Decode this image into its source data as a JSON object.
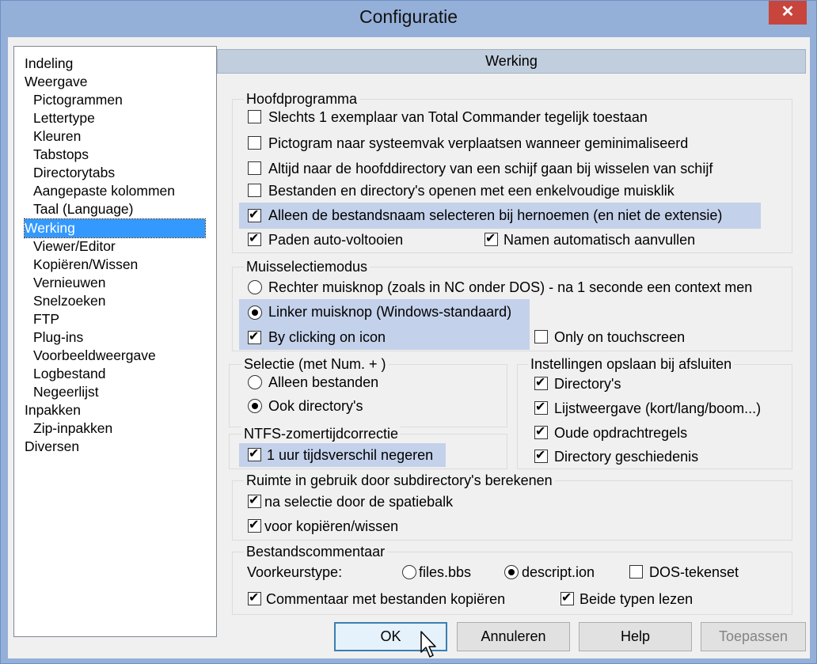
{
  "window": {
    "title": "Configuratie",
    "close_symbol": "✕"
  },
  "tree": {
    "items": [
      {
        "label": "Indeling",
        "level": 0
      },
      {
        "label": "Weergave",
        "level": 0
      },
      {
        "label": "Pictogrammen",
        "level": 1
      },
      {
        "label": "Lettertype",
        "level": 1
      },
      {
        "label": "Kleuren",
        "level": 1
      },
      {
        "label": "Tabstops",
        "level": 1
      },
      {
        "label": "Directorytabs",
        "level": 1
      },
      {
        "label": "Aangepaste kolommen",
        "level": 1
      },
      {
        "label": "Taal (Language)",
        "level": 1
      },
      {
        "label": "Werking",
        "level": 0,
        "selected": true
      },
      {
        "label": "Viewer/Editor",
        "level": 1
      },
      {
        "label": "Kopiëren/Wissen",
        "level": 1
      },
      {
        "label": "Vernieuwen",
        "level": 1
      },
      {
        "label": "Snelzoeken",
        "level": 1
      },
      {
        "label": "FTP",
        "level": 1
      },
      {
        "label": "Plug-ins",
        "level": 1
      },
      {
        "label": "Voorbeeldweergave",
        "level": 1
      },
      {
        "label": "Logbestand",
        "level": 1
      },
      {
        "label": "Negeerlijst",
        "level": 1
      },
      {
        "label": "Inpakken",
        "level": 0
      },
      {
        "label": "Zip-inpakken",
        "level": 1
      },
      {
        "label": "Diversen",
        "level": 0
      }
    ]
  },
  "panel": {
    "header": "Werking"
  },
  "hoofdprogramma": {
    "title": "Hoofdprogramma",
    "options": [
      {
        "label": "Slechts 1 exemplaar van Total Commander tegelijk toestaan",
        "checked": false
      },
      {
        "label": "Pictogram naar systeemvak verplaatsen wanneer geminimaliseerd",
        "checked": false
      },
      {
        "label": "Altijd naar de hoofddirectory van een schijf gaan bij wisselen van schijf",
        "checked": false
      },
      {
        "label": "Bestanden en directory's openen met een enkelvoudige muisklik",
        "checked": false
      },
      {
        "label": "Alleen de bestandsnaam selecteren bij hernoemen (en niet de extensie)",
        "checked": true
      },
      {
        "label": "Paden auto-voltooien",
        "checked": true
      },
      {
        "label": "Namen automatisch aanvullen",
        "checked": true
      }
    ]
  },
  "muisselectie": {
    "title": "Muisselectiemodus",
    "options": [
      {
        "label": "Rechter muisknop (zoals in NC onder DOS) - na 1 seconde een context men",
        "checked": false
      },
      {
        "label": "Linker muisknop (Windows-standaard)",
        "checked": true
      },
      {
        "label": "By clicking on icon",
        "checked": true
      },
      {
        "label": "Only on touchscreen",
        "checked": false
      }
    ]
  },
  "selectie": {
    "title": "Selectie (met Num. + )",
    "options": [
      {
        "label": "Alleen bestanden",
        "checked": false
      },
      {
        "label": "Ook directory's",
        "checked": true
      }
    ]
  },
  "instellingen": {
    "title": "Instellingen opslaan bij afsluiten",
    "options": [
      {
        "label": "Directory's",
        "checked": true
      },
      {
        "label": "Lijstweergave (kort/lang/boom...)",
        "checked": true
      },
      {
        "label": "Oude opdrachtregels",
        "checked": true
      },
      {
        "label": "Directory geschiedenis",
        "checked": true
      }
    ]
  },
  "ntfs": {
    "title": "NTFS-zomertijdcorrectie",
    "options": [
      {
        "label": "1 uur tijdsverschil negeren",
        "checked": true
      }
    ]
  },
  "ruimte": {
    "title": "Ruimte in gebruik door subdirectory's berekenen",
    "options": [
      {
        "label": "na selectie door de spatiebalk",
        "checked": true
      },
      {
        "label": "voor kopiëren/wissen",
        "checked": true
      }
    ]
  },
  "bestandscommentaar": {
    "title": "Bestandscommentaar",
    "type_label": "Voorkeurstype:",
    "options": [
      {
        "label": "files.bbs",
        "checked": false
      },
      {
        "label": "descript.ion",
        "checked": true
      },
      {
        "label": "DOS-tekenset",
        "checked": false
      },
      {
        "label": "Commentaar met bestanden kopiëren",
        "checked": true
      },
      {
        "label": "Beide typen lezen",
        "checked": true
      }
    ]
  },
  "buttons": {
    "ok": "OK",
    "cancel": "Annuleren",
    "help": "Help",
    "apply": "Toepassen"
  },
  "colors": {
    "selection": "#3399ff",
    "highlight": "#c4d1ea",
    "titlebar": "#94b0d8",
    "close": "#c7453c"
  }
}
